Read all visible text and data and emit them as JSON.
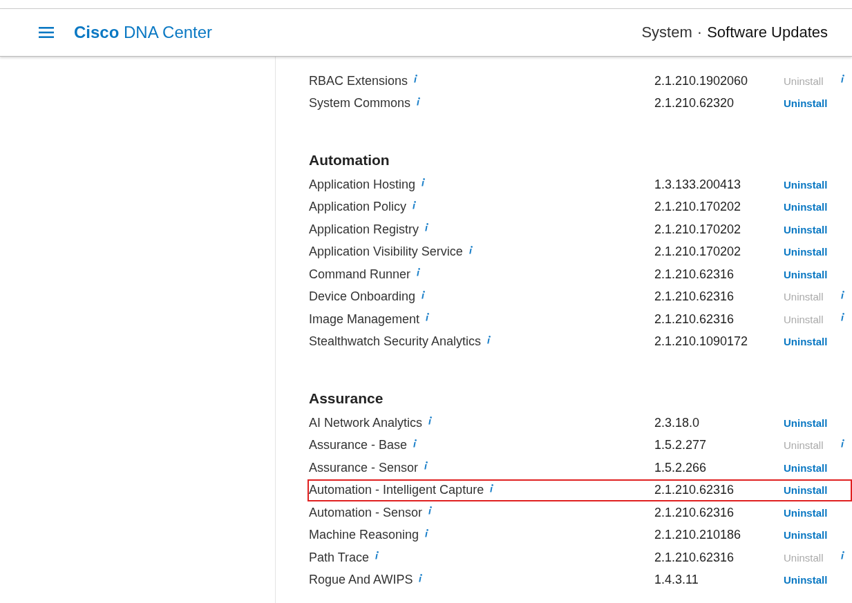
{
  "header": {
    "brand_bold": "Cisco",
    "brand": "DNA Center",
    "breadcrumb_parent": "System",
    "breadcrumb_separator": "·",
    "breadcrumb_current": "Software Updates"
  },
  "groups": [
    {
      "items": [
        {
          "name": "RBAC Extensions",
          "version": "2.1.210.1902060",
          "action": "Uninstall",
          "disabled": true,
          "highlighted": false
        },
        {
          "name": "System Commons",
          "version": "2.1.210.62320",
          "action": "Uninstall",
          "disabled": false,
          "highlighted": false
        }
      ]
    },
    {
      "title": "Automation",
      "items": [
        {
          "name": "Application Hosting",
          "version": "1.3.133.200413",
          "action": "Uninstall",
          "disabled": false,
          "highlighted": false
        },
        {
          "name": "Application Policy",
          "version": "2.1.210.170202",
          "action": "Uninstall",
          "disabled": false,
          "highlighted": false
        },
        {
          "name": "Application Registry",
          "version": "2.1.210.170202",
          "action": "Uninstall",
          "disabled": false,
          "highlighted": false
        },
        {
          "name": "Application Visibility Service",
          "version": "2.1.210.170202",
          "action": "Uninstall",
          "disabled": false,
          "highlighted": false
        },
        {
          "name": "Command Runner",
          "version": "2.1.210.62316",
          "action": "Uninstall",
          "disabled": false,
          "highlighted": false
        },
        {
          "name": "Device Onboarding",
          "version": "2.1.210.62316",
          "action": "Uninstall",
          "disabled": true,
          "highlighted": false
        },
        {
          "name": "Image Management",
          "version": "2.1.210.62316",
          "action": "Uninstall",
          "disabled": true,
          "highlighted": false
        },
        {
          "name": "Stealthwatch Security Analytics",
          "version": "2.1.210.1090172",
          "action": "Uninstall",
          "disabled": false,
          "highlighted": false
        }
      ]
    },
    {
      "title": "Assurance",
      "items": [
        {
          "name": "AI Network Analytics",
          "version": "2.3.18.0",
          "action": "Uninstall",
          "disabled": false,
          "highlighted": false
        },
        {
          "name": "Assurance - Base",
          "version": "1.5.2.277",
          "action": "Uninstall",
          "disabled": true,
          "highlighted": false
        },
        {
          "name": "Assurance - Sensor",
          "version": "1.5.2.266",
          "action": "Uninstall",
          "disabled": false,
          "highlighted": false
        },
        {
          "name": "Automation - Intelligent Capture",
          "version": "2.1.210.62316",
          "action": "Uninstall",
          "disabled": false,
          "highlighted": true
        },
        {
          "name": "Automation - Sensor",
          "version": "2.1.210.62316",
          "action": "Uninstall",
          "disabled": false,
          "highlighted": false
        },
        {
          "name": "Machine Reasoning",
          "version": "2.1.210.210186",
          "action": "Uninstall",
          "disabled": false,
          "highlighted": false
        },
        {
          "name": "Path Trace",
          "version": "2.1.210.62316",
          "action": "Uninstall",
          "disabled": true,
          "highlighted": false
        },
        {
          "name": "Rogue And AWIPS",
          "version": "1.4.3.11",
          "action": "Uninstall",
          "disabled": false,
          "highlighted": false
        }
      ]
    }
  ]
}
